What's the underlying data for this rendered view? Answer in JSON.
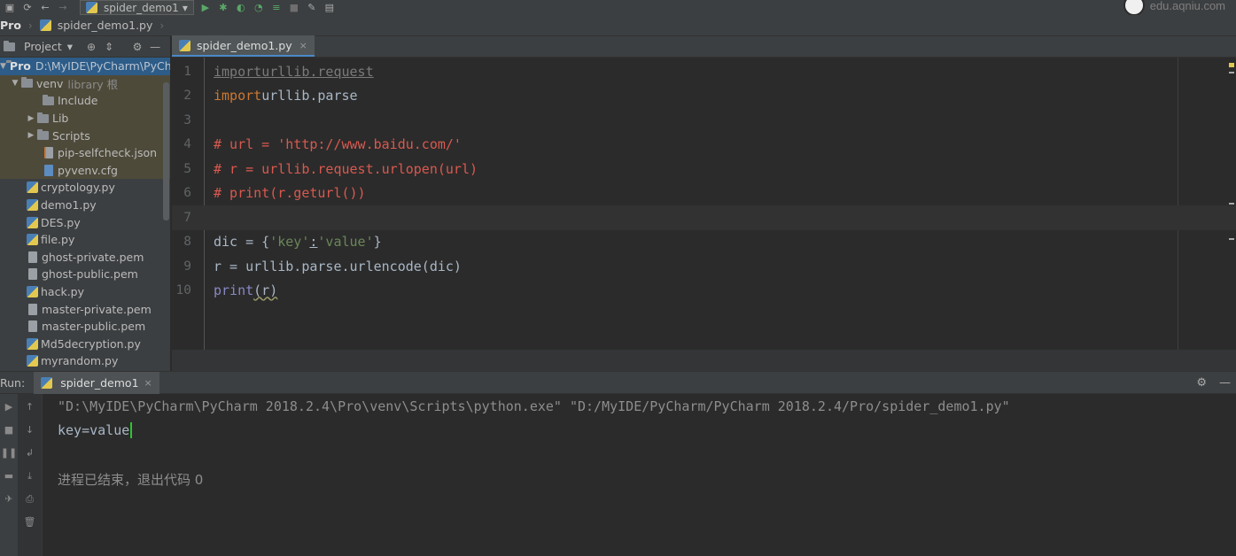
{
  "toolbar": {
    "run_config": "spider_demo1",
    "logo_text": "edu.aqniu.com"
  },
  "navbar": {
    "project": "Pro",
    "file": "spider_demo1.py"
  },
  "project_panel": {
    "title": "Project",
    "root": {
      "name": "Pro",
      "path": "D:\\MyIDE\\PyCharm\\PyCharm"
    },
    "venv": {
      "name": "venv",
      "note": "library 根"
    },
    "venv_children": [
      "Include",
      "Lib",
      "Scripts",
      "pip-selfcheck.json",
      "pyvenv.cfg"
    ],
    "files": [
      "cryptology.py",
      "demo1.py",
      "DES.py",
      "file.py",
      "ghost-private.pem",
      "ghost-public.pem",
      "hack.py",
      "master-private.pem",
      "master-public.pem",
      "Md5decryption.py",
      "myrandom.py"
    ]
  },
  "editor": {
    "tab": "spider_demo1.py",
    "line_numbers": [
      "1",
      "2",
      "3",
      "4",
      "5",
      "6",
      "7",
      "8",
      "9",
      "10"
    ],
    "lines": {
      "l1_kw": "import",
      "l1_rest": " urllib.request",
      "l2_kw": "import",
      "l2_rest": " urllib.parse",
      "l4": "# url = 'http://www.baidu.com/'",
      "l5": "# r = urllib.request.urlopen(url)",
      "l6": "# print(r.geturl())",
      "l8_a": "dic = {",
      "l8_s1": "'key'",
      "l8_c": ":",
      "l8_s2": "'value'",
      "l8_b": "}",
      "l9": "r = urllib.parse.urlencode(dic)",
      "l10_fn": "print",
      "l10_rest": "(r)"
    }
  },
  "run_panel": {
    "label": "Run:",
    "tab": "spider_demo1",
    "output": [
      "\"D:\\MyIDE\\PyCharm\\PyCharm 2018.2.4\\Pro\\venv\\Scripts\\python.exe\" \"D:/MyIDE/PyCharm/PyCharm 2018.2.4/Pro/spider_demo1.py\"",
      "key=value",
      "",
      "进程已结束，退出代码 0"
    ]
  },
  "colors": {
    "accent": "#4a88c7",
    "comment": "#d9594f",
    "keyword": "#cc7832",
    "string": "#6a8759"
  }
}
